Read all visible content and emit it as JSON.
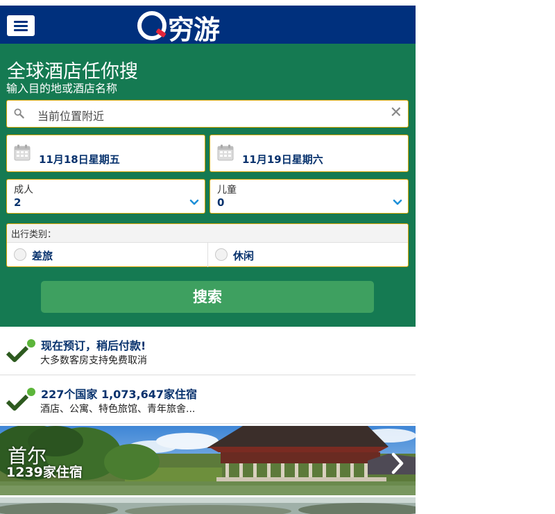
{
  "header": {
    "brand": "穷游",
    "colors": {
      "header_bg": "#00307d",
      "logo_accent": "#e2263b"
    },
    "icons": {
      "menu": "hamburger-menu-icon",
      "logo": "q-logo-icon"
    }
  },
  "search": {
    "title": "全球酒店任你搜",
    "subtitle": "输入目的地或酒店名称",
    "destination_value": "当前位置附近",
    "checkin": "11月18日星期五",
    "checkout": "11月19日星期六",
    "adults_label": "成人",
    "adults_value": "2",
    "children_label": "儿童",
    "children_value": "0",
    "trip_type_label": "出行类别：",
    "trip_options": [
      "差旅",
      "休闲"
    ],
    "button_label": "搜索",
    "colors": {
      "panel_bg": "#157a52",
      "button_bg": "#3ea060",
      "field_border": "#d9a400",
      "value_text": "#07326d"
    }
  },
  "promos": [
    {
      "title": "现在预订，稍后付款!",
      "subtitle": "大多数客房支持免费取消"
    },
    {
      "title": "227个国家 1,073,647家住宿",
      "subtitle": "酒店、公寓、特色旅馆、青年旅舍..."
    }
  ],
  "cities": [
    {
      "name": "首尔",
      "count": "1239家住宿"
    }
  ]
}
